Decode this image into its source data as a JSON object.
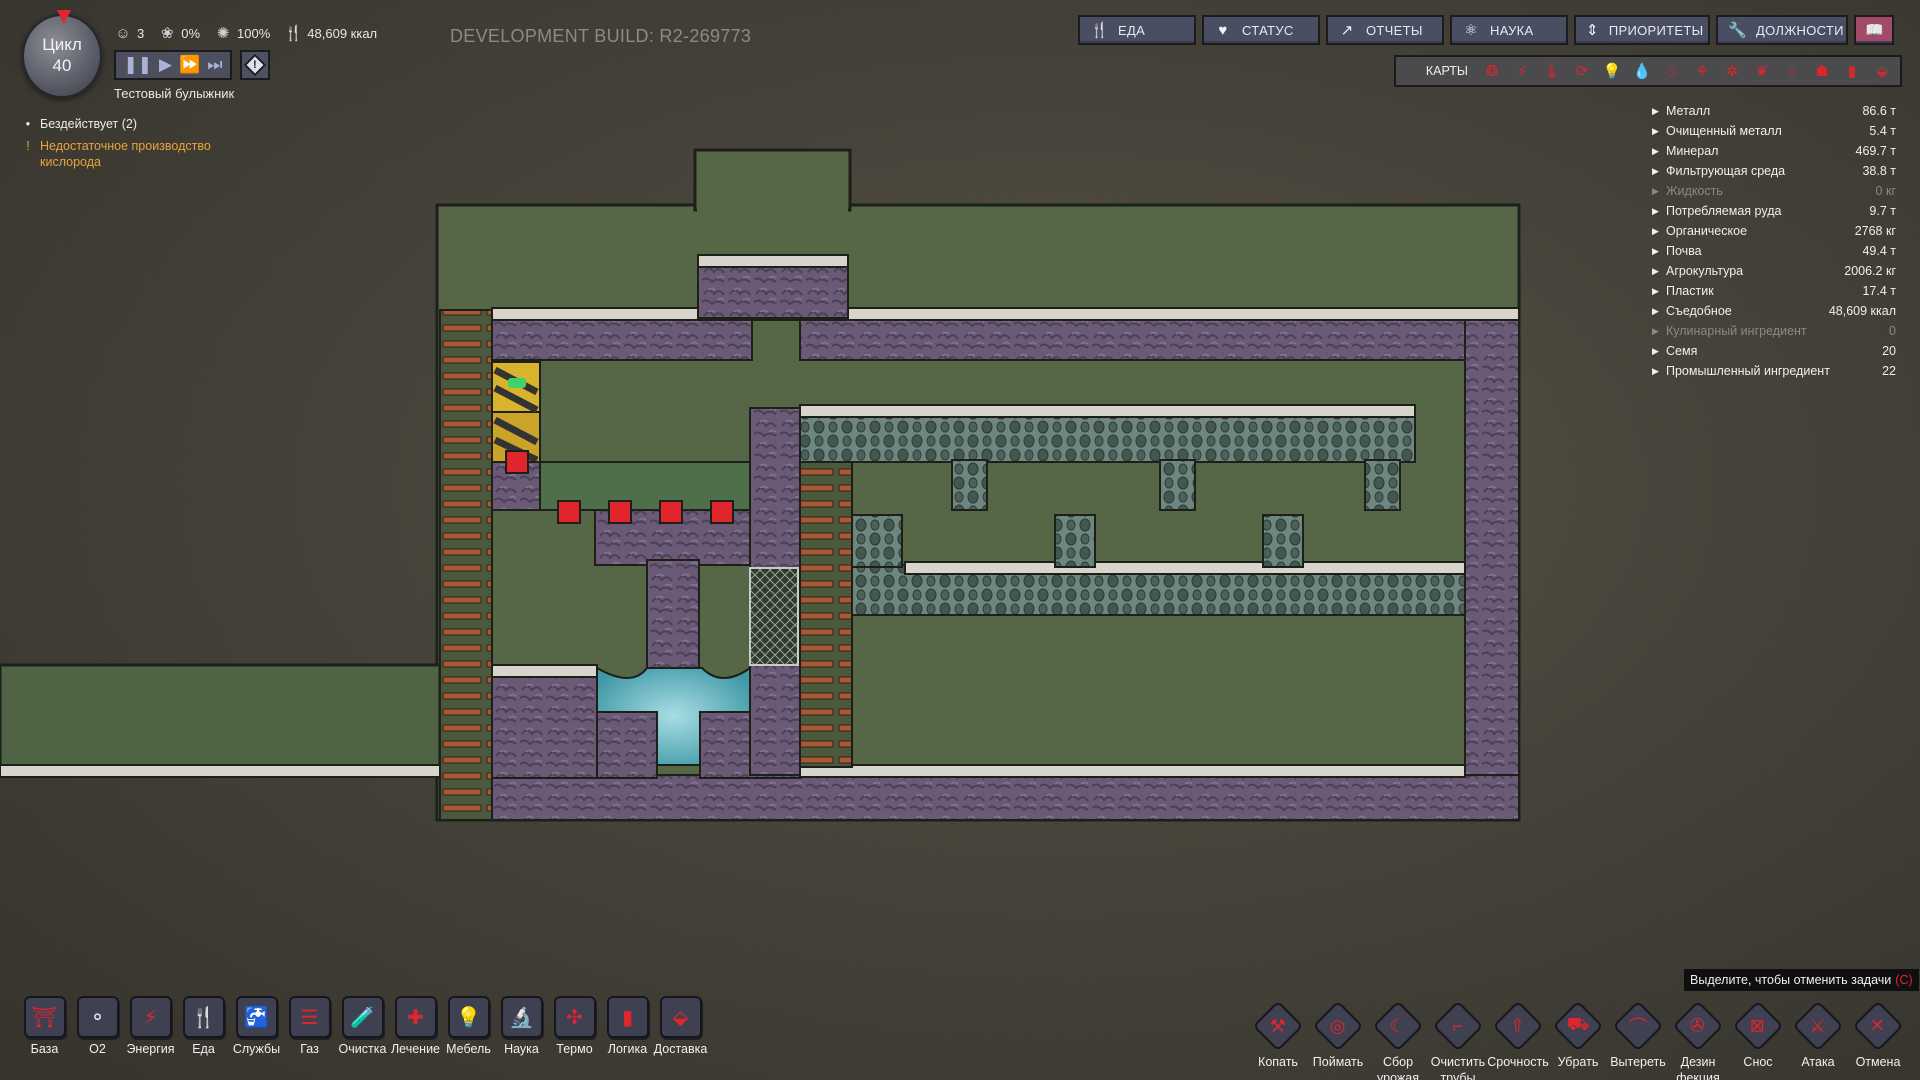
{
  "hud": {
    "cycle_label": "Цикл",
    "cycle_number": "40",
    "duplicants": "3",
    "stress": "0%",
    "health": "100%",
    "calories": "48,609 ккал",
    "colony_name": "Тестовый булыжник",
    "dev_build": "DEVELOPMENT BUILD: R2-269773"
  },
  "speed": {
    "pause": "❚❚",
    "normal": "▶",
    "fast": "⏩",
    "ultra": "⏭"
  },
  "notifications": [
    {
      "type": "info",
      "bullet": "•",
      "text": "Бездействует (2)"
    },
    {
      "type": "warning",
      "bullet": "!",
      "text": "Недостаточное производство кислорода"
    }
  ],
  "menu": [
    {
      "label": "ЕДА",
      "icon": "fork-knife-icon",
      "glyph": "🍴"
    },
    {
      "label": "СТАТУС",
      "icon": "heart-icon",
      "glyph": "♥"
    },
    {
      "label": "ОТЧЕТЫ",
      "icon": "chart-line-icon",
      "glyph": "↗"
    },
    {
      "label": "НАУКА",
      "icon": "atom-icon",
      "glyph": "⚛"
    },
    {
      "label": "ПРИОРИТЕТЫ",
      "icon": "priority-arrows-icon",
      "glyph": "⇕"
    },
    {
      "label": "ДОЛЖНОСТИ",
      "icon": "wrench-icon",
      "glyph": "🔧"
    }
  ],
  "codex_glyph": "📖",
  "overlays": {
    "label": "КАРТЫ",
    "items": [
      {
        "name": "oxygen-overlay-icon",
        "glyph": "❂"
      },
      {
        "name": "power-overlay-icon",
        "glyph": "⚡"
      },
      {
        "name": "temperature-overlay-icon",
        "glyph": "🌡"
      },
      {
        "name": "materials-overlay-icon",
        "glyph": "⟳"
      },
      {
        "name": "light-overlay-icon",
        "glyph": "💡"
      },
      {
        "name": "liquid-plumbing-overlay-icon",
        "glyph": "💧"
      },
      {
        "name": "gas-ventilation-overlay-icon",
        "glyph": "♨"
      },
      {
        "name": "decor-overlay-icon",
        "glyph": "⚘"
      },
      {
        "name": "germ-overlay-icon",
        "glyph": "✲"
      },
      {
        "name": "farming-overlay-icon",
        "glyph": "❦"
      },
      {
        "name": "rooms-overlay-icon",
        "glyph": "⌂"
      },
      {
        "name": "exosuit-overlay-icon",
        "glyph": "☗"
      },
      {
        "name": "automation-overlay-icon",
        "glyph": "▮"
      },
      {
        "name": "conveyor-overlay-icon",
        "glyph": "⬙"
      }
    ]
  },
  "resources": [
    {
      "name": "Металл",
      "value": "86.6 т",
      "dim": false
    },
    {
      "name": "Очищенный металл",
      "value": "5.4 т",
      "dim": false
    },
    {
      "name": "Минерал",
      "value": "469.7 т",
      "dim": false
    },
    {
      "name": "Фильтрующая среда",
      "value": "38.8 т",
      "dim": false
    },
    {
      "name": "Жидкость",
      "value": "0 кг",
      "dim": true
    },
    {
      "name": "Потребляемая руда",
      "value": "9.7 т",
      "dim": false
    },
    {
      "name": "Органическое",
      "value": "2768 кг",
      "dim": false
    },
    {
      "name": "Почва",
      "value": "49.4 т",
      "dim": false
    },
    {
      "name": "Агрокультура",
      "value": "2006.2 кг",
      "dim": false
    },
    {
      "name": "Пластик",
      "value": "17.4 т",
      "dim": false
    },
    {
      "name": "Съедобное",
      "value": "48,609 ккал",
      "dim": false
    },
    {
      "name": "Кулинарный ингредиент",
      "value": "0",
      "dim": true
    },
    {
      "name": "Семя",
      "value": "20",
      "dim": false
    },
    {
      "name": "Промышленный ингредиент",
      "value": "22",
      "dim": false
    }
  ],
  "build_menu": [
    {
      "label": "База",
      "icon": "base-icon",
      "glyph": "⛩"
    },
    {
      "label": "O2",
      "icon": "oxygen-icon",
      "glyph": "⚬"
    },
    {
      "label": "Энергия",
      "icon": "power-plug-icon",
      "glyph": "⚡"
    },
    {
      "label": "Еда",
      "icon": "food-icon",
      "glyph": "🍴"
    },
    {
      "label": "Службы",
      "icon": "plumbing-icon",
      "glyph": "🚰"
    },
    {
      "label": "Газ",
      "icon": "ventilation-icon",
      "glyph": "☰"
    },
    {
      "label": "Очистка",
      "icon": "refinement-icon",
      "glyph": "🧪"
    },
    {
      "label": "Лечение",
      "icon": "medical-icon",
      "glyph": "✚"
    },
    {
      "label": "Мебель",
      "icon": "furniture-lamp-icon",
      "glyph": "💡"
    },
    {
      "label": "Наука",
      "icon": "microscope-icon",
      "glyph": "🔬"
    },
    {
      "label": "Термо",
      "icon": "fan-icon",
      "glyph": "✣"
    },
    {
      "label": "Логика",
      "icon": "automation-icon",
      "glyph": "▮"
    },
    {
      "label": "Доставка",
      "icon": "shipping-icon",
      "glyph": "⬙"
    }
  ],
  "tool_tip": {
    "text": "Выделите, чтобы отменить задачи",
    "key": "(C)"
  },
  "tools": [
    {
      "label": "Копать",
      "icon": "shovel-icon",
      "glyph": "⚒"
    },
    {
      "label": "Поймать",
      "icon": "net-icon",
      "glyph": "◎"
    },
    {
      "label": "Сбор\nурожая",
      "icon": "sickle-icon",
      "glyph": "☾"
    },
    {
      "label": "Очистить\nтрубы",
      "icon": "pipe-icon",
      "glyph": "⌐"
    },
    {
      "label": "Срочность",
      "icon": "priority-up-icon",
      "glyph": "⇧"
    },
    {
      "label": "Убрать",
      "icon": "sweep-cart-icon",
      "glyph": "⛟"
    },
    {
      "label": "Вытереть",
      "icon": "mop-icon",
      "glyph": "⌒"
    },
    {
      "label": "Дезин\nфекция",
      "icon": "spray-icon",
      "glyph": "✇"
    },
    {
      "label": "Снос",
      "icon": "deconstruct-icon",
      "glyph": "⊠"
    },
    {
      "label": "Атака",
      "icon": "attack-icon",
      "glyph": "⚔"
    },
    {
      "label": "Отмена",
      "icon": "cancel-x-icon",
      "glyph": "✕"
    }
  ],
  "colors": {
    "accent_red": "#e0262c",
    "warning": "#e9a53a",
    "menu_bg": "#4a4e63",
    "codex_bg": "#a24a6a",
    "room_bg": "#566748",
    "rock": "#6d5b78"
  }
}
